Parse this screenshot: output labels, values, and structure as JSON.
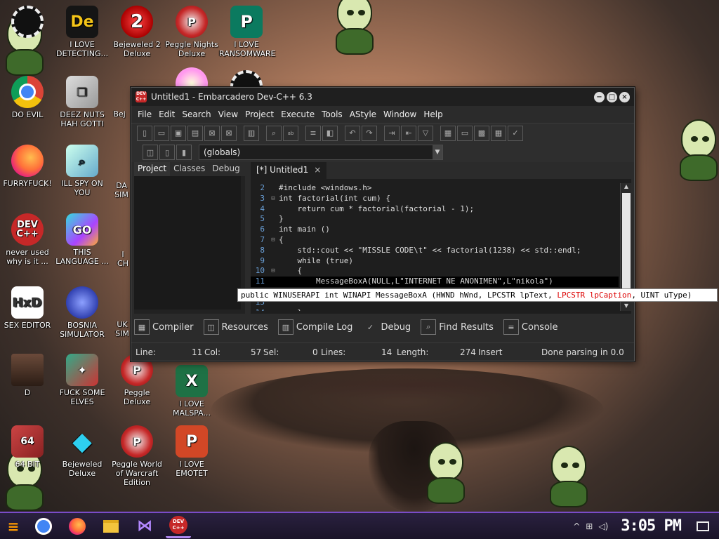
{
  "desktop": {
    "icons": [
      {
        "label": "",
        "icon": "recycle-icon"
      },
      {
        "label": "I LOVE DETECTING...",
        "icon": "de-icon"
      },
      {
        "label": "Bejeweled 2 Deluxe",
        "icon": "bejeweled2-icon"
      },
      {
        "label": "Peggle Nights Deluxe",
        "icon": "peggle-icon"
      },
      {
        "label": "I LOVE RANSOMWARE",
        "icon": "publisher-icon"
      },
      {
        "label": "DO EVIL",
        "icon": "chrome-icon"
      },
      {
        "label": "DEEZ NUTS HAH GOTTI",
        "icon": "copy-icon"
      },
      {
        "label": "Bej",
        "icon": "bejeweled-icon"
      },
      {
        "label": "FURRYFUCK!",
        "icon": "firefox-icon"
      },
      {
        "label": "ILL SPY ON YOU",
        "icon": "spy-icon"
      },
      {
        "label": "SIM",
        "icon": "sim-icon"
      },
      {
        "label": "never used why is it ...",
        "icon": "devcpp-icon"
      },
      {
        "label": "THIS LANGUAGE ...",
        "icon": "goland-icon"
      },
      {
        "label": "CH",
        "icon": "ch-icon"
      },
      {
        "label": "SEX EDITOR",
        "icon": "hxd-icon"
      },
      {
        "label": "BOSNIA SIMULATOR",
        "icon": "bosnia-icon"
      },
      {
        "label": "SIM",
        "icon": "uk-icon"
      },
      {
        "label": "D",
        "icon": "lady-icon"
      },
      {
        "label": "FUCK SOME ELVES",
        "icon": "elves-icon"
      },
      {
        "label": "Peggle Deluxe",
        "icon": "peggle-deluxe-icon"
      },
      {
        "label": "I LOVE MALSPA...",
        "icon": "excel-icon"
      },
      {
        "label": "64 BIT",
        "icon": "r64-icon"
      },
      {
        "label": "Bejeweled Deluxe",
        "icon": "diamond-icon"
      },
      {
        "label": "Peggle World of Warcraft Edition",
        "icon": "peggle-wow-icon"
      },
      {
        "label": "I LOVE EMOTET",
        "icon": "powerpoint-icon"
      }
    ],
    "icon_extras": {
      "bej_abbrev": "Bej",
      "uk_abbrev": "UK",
      "sim_abbrev": "SIM",
      "da_abbrev": "DA",
      "i_abbrev": "I",
      "ch_abbrev": "CH"
    }
  },
  "window": {
    "title": "Untitled1 - Embarcadero Dev-C++ 6.3",
    "icon_text": "DEV C++",
    "minimize": "−",
    "maximize": "□",
    "close": "×"
  },
  "menu": [
    "File",
    "Edit",
    "Search",
    "View",
    "Project",
    "Execute",
    "Tools",
    "AStyle",
    "Window",
    "Help"
  ],
  "toolbar2": {
    "scope": "(globals)"
  },
  "left_tabs": [
    "Project",
    "Classes",
    "Debug"
  ],
  "editor_tab": {
    "label": "[*] Untitled1",
    "close": "×"
  },
  "code_lines": [
    {
      "n": "2",
      "fold": "",
      "text": "#include <windows.h>"
    },
    {
      "n": "3",
      "fold": "⊟",
      "text": "int factorial(int cum) {"
    },
    {
      "n": "4",
      "fold": "",
      "text": "    return cum * factorial(factorial - 1);"
    },
    {
      "n": "5",
      "fold": "",
      "text": "}"
    },
    {
      "n": "6",
      "fold": "",
      "text": "int main ()"
    },
    {
      "n": "7",
      "fold": "⊟",
      "text": "{"
    },
    {
      "n": "8",
      "fold": "",
      "text": "    std::cout << \"MISSLE CODE\\t\" << factorial(1238) << std::endl;"
    },
    {
      "n": "9",
      "fold": "",
      "text": "    while (true)"
    },
    {
      "n": "10",
      "fold": "⊟",
      "text": "    {"
    },
    {
      "n": "11",
      "fold": "",
      "text": "        MessageBoxA(NULL,L\"INTERNET NE ANONIMEN\",L\"nikola\")"
    },
    {
      "n": "12",
      "fold": "",
      "text": ""
    },
    {
      "n": "13",
      "fold": "",
      "text": ""
    },
    {
      "n": "14",
      "fold": "",
      "text": "    }"
    }
  ],
  "tooltip": {
    "before": "public WINUSERAPI int WINAPI MessageBoxA (HWND hWnd, LPCSTR lpText, ",
    "highlight": "LPCSTR lpCaption",
    "after": ", UINT uType)"
  },
  "bottom_tabs": [
    {
      "label": "Compiler",
      "icon": "compiler-icon"
    },
    {
      "label": "Resources",
      "icon": "resources-icon"
    },
    {
      "label": "Compile Log",
      "icon": "compile-log-icon"
    },
    {
      "label": "Debug",
      "icon": "debug-check-icon"
    },
    {
      "label": "Find Results",
      "icon": "find-results-icon"
    },
    {
      "label": "Console",
      "icon": "console-icon"
    }
  ],
  "status": {
    "line_label": "Line:",
    "line_val": "11",
    "col_label": "Col:",
    "col_val": "57",
    "sel_label": "Sel:",
    "sel_val": "0",
    "lines_label": "Lines:",
    "lines_val": "14",
    "length_label": "Length:",
    "length_val": "274",
    "mode": "Insert",
    "parse": "Done parsing in 0.0"
  },
  "taskbar": {
    "clock": "3:05 PM",
    "apps": [
      "chrome-icon",
      "firefox-icon",
      "explorer-icon",
      "visual-studio-icon",
      "devcpp-icon"
    ],
    "devcpp_text": "DEV C++"
  }
}
